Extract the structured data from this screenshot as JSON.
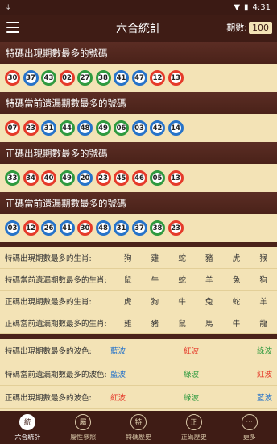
{
  "status": {
    "time": "4:31"
  },
  "header": {
    "title": "六合統計",
    "period_label": "期數:",
    "period_value": "100"
  },
  "sections": [
    {
      "title": "特碼出現期數最多的號碼",
      "balls": [
        {
          "n": "30",
          "c": "red"
        },
        {
          "n": "37",
          "c": "blue"
        },
        {
          "n": "43",
          "c": "green"
        },
        {
          "n": "02",
          "c": "red"
        },
        {
          "n": "27",
          "c": "green"
        },
        {
          "n": "38",
          "c": "green"
        },
        {
          "n": "41",
          "c": "blue"
        },
        {
          "n": "47",
          "c": "blue"
        },
        {
          "n": "12",
          "c": "red"
        },
        {
          "n": "13",
          "c": "red"
        }
      ]
    },
    {
      "title": "特碼當前遺漏期數最多的號碼",
      "balls": [
        {
          "n": "07",
          "c": "red"
        },
        {
          "n": "23",
          "c": "red"
        },
        {
          "n": "31",
          "c": "blue"
        },
        {
          "n": "44",
          "c": "green"
        },
        {
          "n": "48",
          "c": "blue"
        },
        {
          "n": "49",
          "c": "green"
        },
        {
          "n": "06",
          "c": "green"
        },
        {
          "n": "03",
          "c": "blue"
        },
        {
          "n": "42",
          "c": "blue"
        },
        {
          "n": "14",
          "c": "blue"
        }
      ]
    },
    {
      "title": "正碼出現期數最多的號碼",
      "balls": [
        {
          "n": "33",
          "c": "green"
        },
        {
          "n": "34",
          "c": "red"
        },
        {
          "n": "40",
          "c": "red"
        },
        {
          "n": "49",
          "c": "green"
        },
        {
          "n": "20",
          "c": "blue"
        },
        {
          "n": "23",
          "c": "red"
        },
        {
          "n": "45",
          "c": "red"
        },
        {
          "n": "46",
          "c": "red"
        },
        {
          "n": "05",
          "c": "green"
        },
        {
          "n": "13",
          "c": "red"
        }
      ]
    },
    {
      "title": "正碼當前遺漏期數最多的號碼",
      "balls": [
        {
          "n": "03",
          "c": "blue"
        },
        {
          "n": "12",
          "c": "red"
        },
        {
          "n": "26",
          "c": "blue"
        },
        {
          "n": "41",
          "c": "blue"
        },
        {
          "n": "30",
          "c": "red"
        },
        {
          "n": "48",
          "c": "blue"
        },
        {
          "n": "31",
          "c": "blue"
        },
        {
          "n": "37",
          "c": "blue"
        },
        {
          "n": "38",
          "c": "green"
        },
        {
          "n": "23",
          "c": "red"
        }
      ]
    }
  ],
  "zodiac_rows": [
    {
      "label": "特碼出現期數最多的生肖:",
      "cells": [
        "狗",
        "雞",
        "蛇",
        "豬",
        "虎",
        "猴"
      ]
    },
    {
      "label": "特碼當前遺漏期數最多的生肖:",
      "cells": [
        "鼠",
        "牛",
        "蛇",
        "羊",
        "兔",
        "狗"
      ]
    },
    {
      "label": "正碼出現期數最多的生肖:",
      "cells": [
        "虎",
        "狗",
        "牛",
        "兔",
        "蛇",
        "羊"
      ]
    },
    {
      "label": "正碼當前遺漏期數最多的生肖:",
      "cells": [
        "雞",
        "豬",
        "鼠",
        "馬",
        "牛",
        "龍"
      ]
    }
  ],
  "wave_rows": [
    {
      "label": "特碼出現期數最多的波色:",
      "cells": [
        {
          "t": "藍波",
          "c": "blue"
        },
        {
          "t": "紅波",
          "c": "red"
        },
        {
          "t": "綠波",
          "c": "green"
        }
      ]
    },
    {
      "label": "特碼當前遺漏期數最多的波色:",
      "cells": [
        {
          "t": "藍波",
          "c": "blue"
        },
        {
          "t": "綠波",
          "c": "green"
        },
        {
          "t": "紅波",
          "c": "red"
        }
      ]
    },
    {
      "label": "正碼出現期數最多的波色:",
      "cells": [
        {
          "t": "紅波",
          "c": "red"
        },
        {
          "t": "綠波",
          "c": "green"
        },
        {
          "t": "藍波",
          "c": "blue"
        }
      ]
    }
  ],
  "bottom_nav": [
    {
      "icon": "統",
      "label": "六合統計",
      "active": true
    },
    {
      "icon": "屬",
      "label": "屬性參照"
    },
    {
      "icon": "特",
      "label": "特碼歷史"
    },
    {
      "icon": "正",
      "label": "正碼歷史"
    },
    {
      "icon": "···",
      "label": "更多"
    }
  ],
  "colors": {
    "header": "#3f1c15",
    "section": "#4a2219",
    "bg": "#f3e3b6",
    "red": "#e53a2a",
    "blue": "#2673c9",
    "green": "#2f9a3f"
  }
}
